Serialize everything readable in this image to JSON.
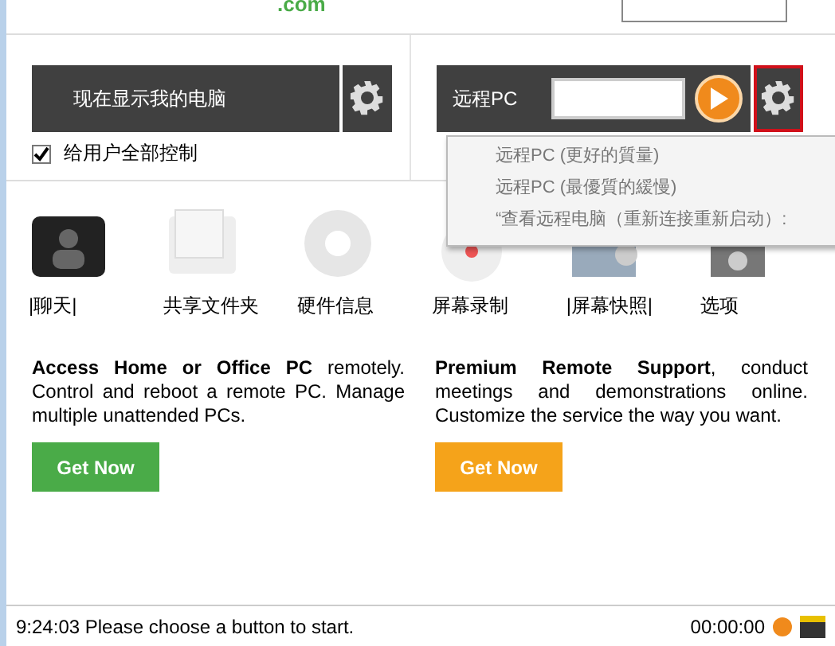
{
  "header": {
    "logo_text": ".com"
  },
  "local_panel": {
    "title": "现在显示我的电脑",
    "checkbox": {
      "label": "给用户全部控制",
      "checked": true
    }
  },
  "remote_panel": {
    "label": "远程PC",
    "settings_highlighted": true
  },
  "remote_menu": {
    "items": [
      {
        "label": "远程PC (更好的質量)",
        "disabled": true
      },
      {
        "label": "远程PC (最優質的緩慢)",
        "disabled": true
      },
      {
        "label": "“查看远程电脑（重新连接重新启动）:",
        "disabled": true
      }
    ]
  },
  "tools": [
    {
      "kind": "chat",
      "label": "|聊天|"
    },
    {
      "kind": "folder",
      "label": "共享文件夹"
    },
    {
      "kind": "hardware",
      "label": "硬件信息"
    },
    {
      "kind": "record",
      "label": "屏幕录制"
    },
    {
      "kind": "snapshot",
      "label": "|屏幕快照|"
    },
    {
      "kind": "options",
      "label": "选项"
    }
  ],
  "offers": [
    {
      "text": "**Access Home or Office PC** remotely. Control and reboot a remote PC. Manage multiple unattended PCs.",
      "button": "Get Now",
      "color": "#4aab48"
    },
    {
      "text": "**Premium Remote Support**, conduct meetings and demonstrations online. Customize the service the way you want.",
      "button": "Get Now",
      "color": "#f5a31a"
    }
  ],
  "status_bar": {
    "message": "9:24:03 Please choose a button to start.",
    "timer": "00:00:00"
  }
}
